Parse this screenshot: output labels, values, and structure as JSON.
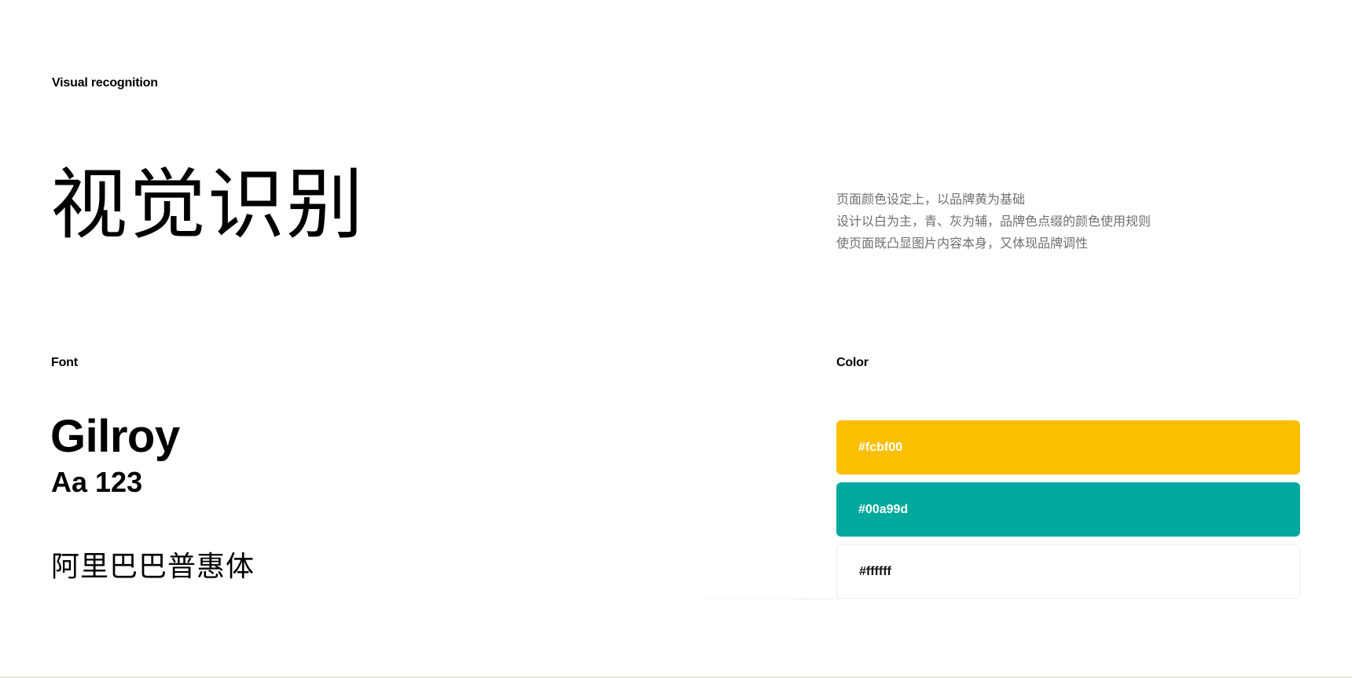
{
  "section_labels": {
    "visual": "Visual recognition",
    "font": "Font",
    "color": "Color"
  },
  "title": "视觉识别",
  "description": [
    "页面颜色设定上，以品牌黄为基础",
    "设计以白为主，青、灰为辅，品牌色点缀的颜色使用规则",
    "使页面既凸显图片内容本身，又体现品牌调性"
  ],
  "font": {
    "name": "Gilroy",
    "sample": "Aa 123",
    "chinese": "阿里巴巴普惠体"
  },
  "colors": [
    {
      "label": "#fcbf00",
      "value": "#fcbf00"
    },
    {
      "label": "#00a99d",
      "value": "#00a99d"
    },
    {
      "label": "#ffffff",
      "value": "#ffffff"
    }
  ]
}
